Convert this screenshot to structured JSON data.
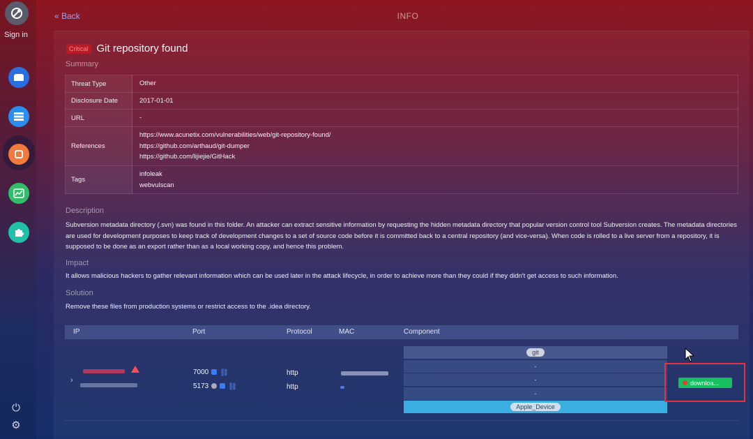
{
  "sidebar": {
    "signin_label": "Sign in",
    "items": [
      {
        "icon": "hat-icon",
        "color": "#2a6fe0"
      },
      {
        "icon": "list-icon",
        "color": "#2a8ef0"
      },
      {
        "icon": "bug-icon",
        "color": "#f27a3c"
      },
      {
        "icon": "chart-icon",
        "color": "#2fbf68"
      },
      {
        "icon": "puzzle-icon",
        "color": "#1fc2a6"
      }
    ]
  },
  "nav": {
    "back_label": "« Back",
    "title": "INFO"
  },
  "vuln": {
    "severity": "Critical",
    "title": "Git repository found",
    "summary_heading": "Summary",
    "summary": [
      {
        "key": "Threat Type",
        "value": "Other"
      },
      {
        "key": "Disclosure Date",
        "value": "2017-01-01"
      },
      {
        "key": "URL",
        "value": "-"
      },
      {
        "key": "References",
        "value_lines": [
          "https://www.acunetix.com/vulnerabilities/web/git-repository-found/",
          "https://github.com/arthaud/git-dumper",
          "https://github.com/lijiejie/GitHack"
        ]
      },
      {
        "key": "Tags",
        "value_lines": [
          "infoleak",
          "webvulscan"
        ]
      }
    ],
    "description_heading": "Description",
    "description": "Subversion metadata directory (.svn) was found in this folder. An attacker can extract sensitive information by requesting the hidden metadata directory that popular version control tool Subversion creates. The metadata directories are used for development purposes to keep track of development changes to a set of source code before it is committed back to a central repository (and vice-versa). When code is rolled to a live server from a repository, it is supposed to be done as an export rather than as a local working copy, and hence this problem.",
    "impact_heading": "Impact",
    "impact": "It allows malicious hackers to gather relevant information which can be used later in the attack lifecycle, in order to achieve more than they could if they didn't get access to such information.",
    "solution_heading": "Solution",
    "solution": "Remove these files from production systems or restrict access to the .idea directory."
  },
  "hosts": {
    "columns": [
      "IP",
      "Port",
      "Protocol",
      "MAC",
      "Component"
    ],
    "ports": [
      "7000",
      "5173"
    ],
    "protocols": [
      "http",
      "http"
    ],
    "components": [
      "git",
      "-",
      "-",
      "-",
      "Apple_Device"
    ],
    "download_label": "downloa..."
  }
}
